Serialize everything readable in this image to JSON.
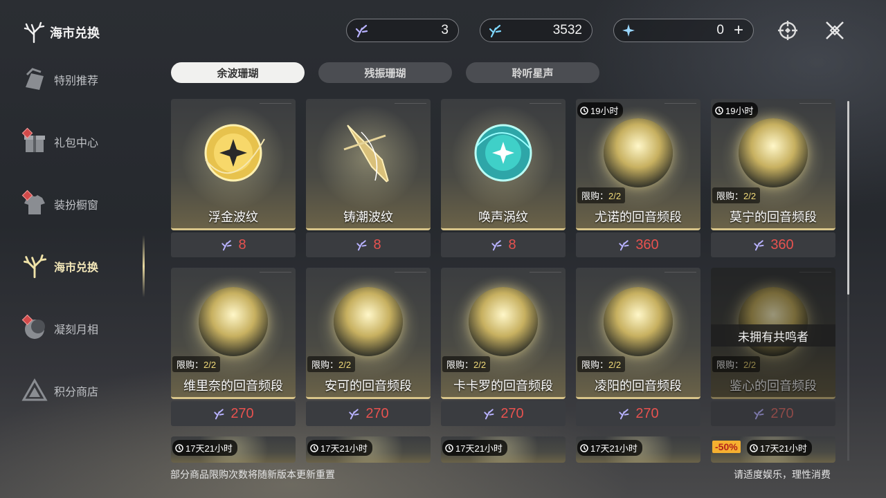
{
  "brand": {
    "title": "海市兑换"
  },
  "sidebar": {
    "items": [
      {
        "label": "特别推荐",
        "icon": "bag-icon",
        "badge": false
      },
      {
        "label": "礼包中心",
        "icon": "gift-icon",
        "badge": true
      },
      {
        "label": "装扮橱窗",
        "icon": "shirt-icon",
        "badge": true
      },
      {
        "label": "海市兑换",
        "icon": "coral-icon",
        "badge": false,
        "active": true
      },
      {
        "label": "凝刻月相",
        "icon": "moon-icon",
        "badge": true
      },
      {
        "label": "积分商店",
        "icon": "triangle-icon",
        "badge": false
      }
    ]
  },
  "currencies": [
    {
      "icon": "coral-currency-icon",
      "value": "3"
    },
    {
      "icon": "oscillate-coral-icon",
      "value": "3532"
    },
    {
      "icon": "star-currency-icon",
      "value": "0",
      "add": "+"
    }
  ],
  "tabs": [
    {
      "label": "余波珊瑚",
      "active": true
    },
    {
      "label": "残振珊瑚",
      "active": false
    },
    {
      "label": "聆听星声",
      "active": false
    }
  ],
  "items": [
    {
      "name": "浮金波纹",
      "price": "8",
      "art": "gold-orb"
    },
    {
      "name": "铸潮波纹",
      "price": "8",
      "art": "blade"
    },
    {
      "name": "唤声涡纹",
      "price": "8",
      "art": "teal-orb"
    },
    {
      "name": "尤诺的回音频段",
      "price": "360",
      "timer": "19小时",
      "limit": "2/2",
      "art": "portrait"
    },
    {
      "name": "莫宁的回音频段",
      "price": "360",
      "timer": "19小时",
      "limit": "2/2",
      "art": "portrait"
    },
    {
      "name": "维里奈的回音频段",
      "price": "270",
      "limit": "2/2",
      "art": "portrait"
    },
    {
      "name": "安可的回音频段",
      "price": "270",
      "limit": "2/2",
      "art": "portrait"
    },
    {
      "name": "卡卡罗的回音频段",
      "price": "270",
      "limit": "2/2",
      "art": "portrait"
    },
    {
      "name": "凌阳的回音频段",
      "price": "270",
      "limit": "2/2",
      "art": "portrait"
    },
    {
      "name": "鉴心的回音频段",
      "price": "270",
      "limit": "2/2",
      "art": "portrait",
      "overlay": "未拥有共鸣者",
      "disabled": true
    },
    {
      "timer": "17天21小时"
    },
    {
      "timer": "17天21小时"
    },
    {
      "timer": "17天21小时"
    },
    {
      "timer": "17天21小时"
    },
    {
      "timer": "17天21小时",
      "discount": "-50%"
    }
  ],
  "labels": {
    "limit_prefix": "限购："
  },
  "footer": {
    "left": "部分商品限购次数将随新版本更新重置",
    "right": "请适度娱乐，理性消费"
  },
  "colors": {
    "price": "#e8524f",
    "accent": "#d9c58a",
    "discount_bg": "#f5b030"
  }
}
